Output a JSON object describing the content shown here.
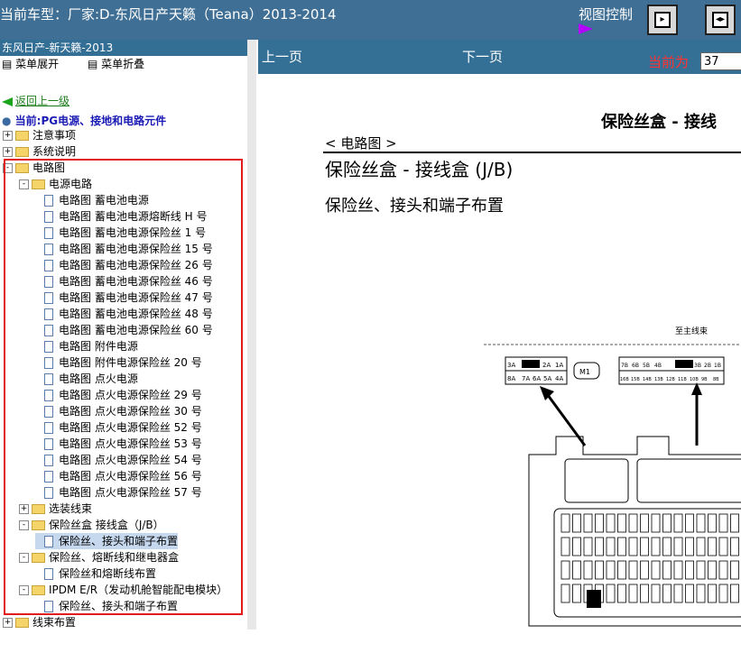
{
  "header": {
    "title": "当前车型：厂家:D-东风日产天籁（Teana）2013-2014",
    "view_control": "视图控制"
  },
  "sidebar": {
    "heading": "东风日产-新天籁-2013",
    "expand_label": "菜单展开",
    "collapse_label": "菜单折叠",
    "back_label": "返回上一级",
    "current_label": "当前:PG电源、接地和电路元件",
    "tree": [
      {
        "label": "注意事项",
        "type": "folder",
        "level": 0,
        "expander": "+"
      },
      {
        "label": "系统说明",
        "type": "folder",
        "level": 0,
        "expander": "+"
      },
      {
        "label": "电路图",
        "type": "folder",
        "level": 0,
        "expander": "-"
      },
      {
        "label": "电源电路",
        "type": "folder",
        "level": 1,
        "expander": "-"
      },
      {
        "label": "电路图 蓄电池电源",
        "type": "doc",
        "level": 2
      },
      {
        "label": "电路图 蓄电池电源熔断线 H 号",
        "type": "doc",
        "level": 2
      },
      {
        "label": "电路图 蓄电池电源保险丝 1 号",
        "type": "doc",
        "level": 2
      },
      {
        "label": "电路图 蓄电池电源保险丝 15 号",
        "type": "doc",
        "level": 2
      },
      {
        "label": "电路图 蓄电池电源保险丝 26 号",
        "type": "doc",
        "level": 2
      },
      {
        "label": "电路图 蓄电池电源保险丝 46 号",
        "type": "doc",
        "level": 2
      },
      {
        "label": "电路图 蓄电池电源保险丝 47 号",
        "type": "doc",
        "level": 2
      },
      {
        "label": "电路图 蓄电池电源保险丝 48 号",
        "type": "doc",
        "level": 2
      },
      {
        "label": "电路图 蓄电池电源保险丝 60 号",
        "type": "doc",
        "level": 2
      },
      {
        "label": "电路图 附件电源",
        "type": "doc",
        "level": 2
      },
      {
        "label": "电路图 附件电源保险丝 20 号",
        "type": "doc",
        "level": 2
      },
      {
        "label": "电路图 点火电源",
        "type": "doc",
        "level": 2
      },
      {
        "label": "电路图 点火电源保险丝 29 号",
        "type": "doc",
        "level": 2
      },
      {
        "label": "电路图 点火电源保险丝 30 号",
        "type": "doc",
        "level": 2
      },
      {
        "label": "电路图 点火电源保险丝 52 号",
        "type": "doc",
        "level": 2
      },
      {
        "label": "电路图 点火电源保险丝 53 号",
        "type": "doc",
        "level": 2
      },
      {
        "label": "电路图 点火电源保险丝 54 号",
        "type": "doc",
        "level": 2
      },
      {
        "label": "电路图 点火电源保险丝 56 号",
        "type": "doc",
        "level": 2
      },
      {
        "label": "电路图 点火电源保险丝 57 号",
        "type": "doc",
        "level": 2
      },
      {
        "label": "选装线束",
        "type": "folder",
        "level": 1,
        "expander": "+"
      },
      {
        "label": "保险丝盒 接线盒（J/B）",
        "type": "folder",
        "level": 1,
        "expander": "-"
      },
      {
        "label": "保险丝、接头和端子布置",
        "type": "doc",
        "level": 2,
        "selected": true
      },
      {
        "label": "保险丝、熔断线和继电器盒",
        "type": "folder",
        "level": 1,
        "expander": "-"
      },
      {
        "label": "保险丝和熔断线布置",
        "type": "doc",
        "level": 2
      },
      {
        "label": "IPDM E/R（发动机舱智能配电模块）",
        "type": "folder",
        "level": 1,
        "expander": "-"
      },
      {
        "label": "保险丝、接头和端子布置",
        "type": "doc",
        "level": 2
      },
      {
        "label": "线束布置",
        "type": "folder",
        "level": 0,
        "expander": "+"
      }
    ]
  },
  "viewer": {
    "prev_label": "上一页",
    "next_label": "下一页",
    "current_page_label": "当前为",
    "current_page_value": "37"
  },
  "document": {
    "page_title": "保险丝盒 - 接线",
    "section": "< 电路图 >",
    "heading": "保险丝盒 - 接线盒 (J/B)",
    "subheading": "保险丝、接头和端子布置",
    "diagram_label_top": "至主线束",
    "connector_left": [
      "3A",
      "2A",
      "1A",
      "8A",
      "7A",
      "6A",
      "5A",
      "4A"
    ],
    "connector_m1": "M1",
    "connector_right_top": [
      "7B",
      "6B",
      "5B",
      "4B",
      "3B",
      "2B",
      "1B"
    ],
    "connector_right_bottom": [
      "16B",
      "15B",
      "14B",
      "13B",
      "12B",
      "11B",
      "10B",
      "9B",
      "8B"
    ]
  }
}
